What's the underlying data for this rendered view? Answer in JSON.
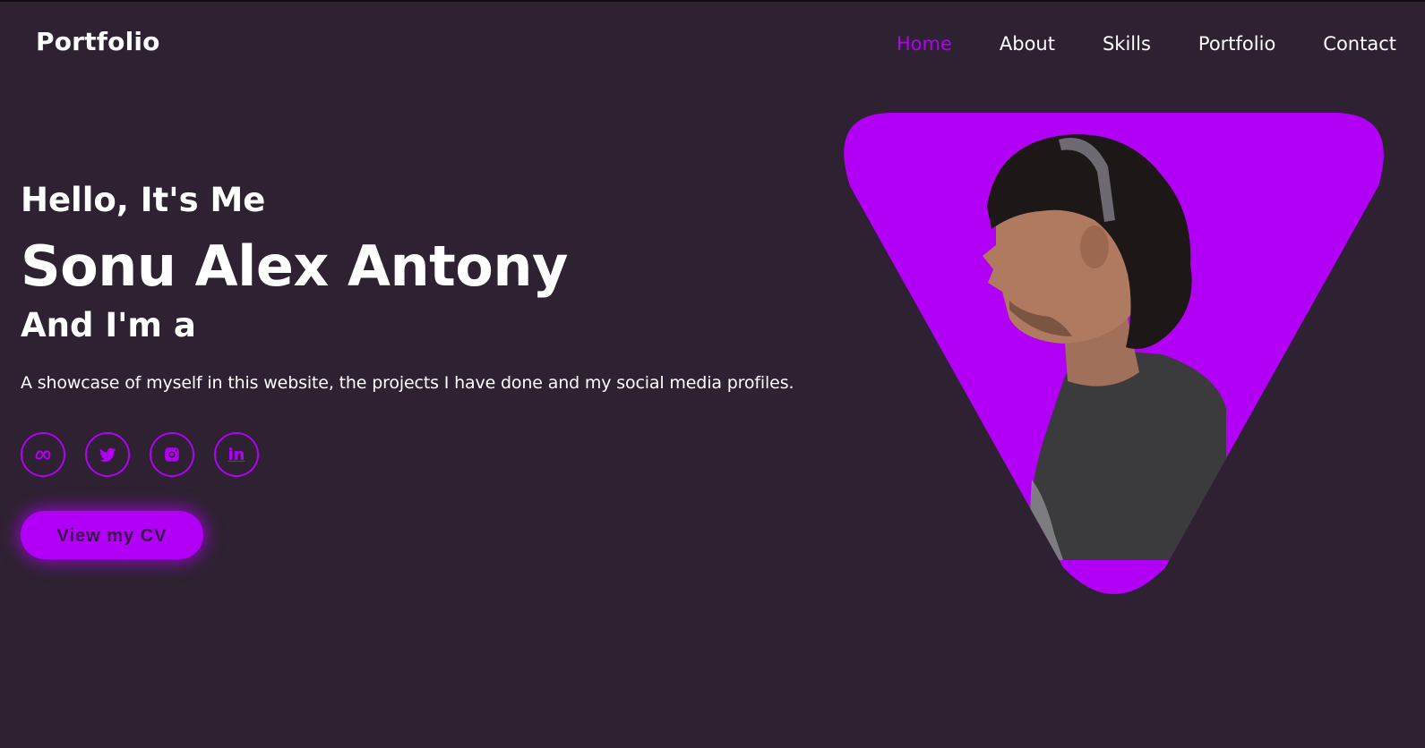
{
  "header": {
    "logo": "Portfolio",
    "nav": [
      {
        "label": "Home",
        "active": true
      },
      {
        "label": "About",
        "active": false
      },
      {
        "label": "Skills",
        "active": false
      },
      {
        "label": "Portfolio",
        "active": false
      },
      {
        "label": "Contact",
        "active": false
      }
    ]
  },
  "hero": {
    "greeting": "Hello, It's Me",
    "name": "Sonu Alex Antony",
    "role_prefix": "And I'm a",
    "description": "A showcase of myself in this website, the projects I have done and my social media profiles.",
    "socials": [
      {
        "icon": "meta-icon"
      },
      {
        "icon": "twitter-icon"
      },
      {
        "icon": "instagram-icon"
      },
      {
        "icon": "linkedin-icon",
        "glyph": "in"
      }
    ],
    "cv_button": "View my CV"
  },
  "colors": {
    "background": "#2e2131",
    "accent": "#b100f5",
    "text": "#ffffff"
  }
}
